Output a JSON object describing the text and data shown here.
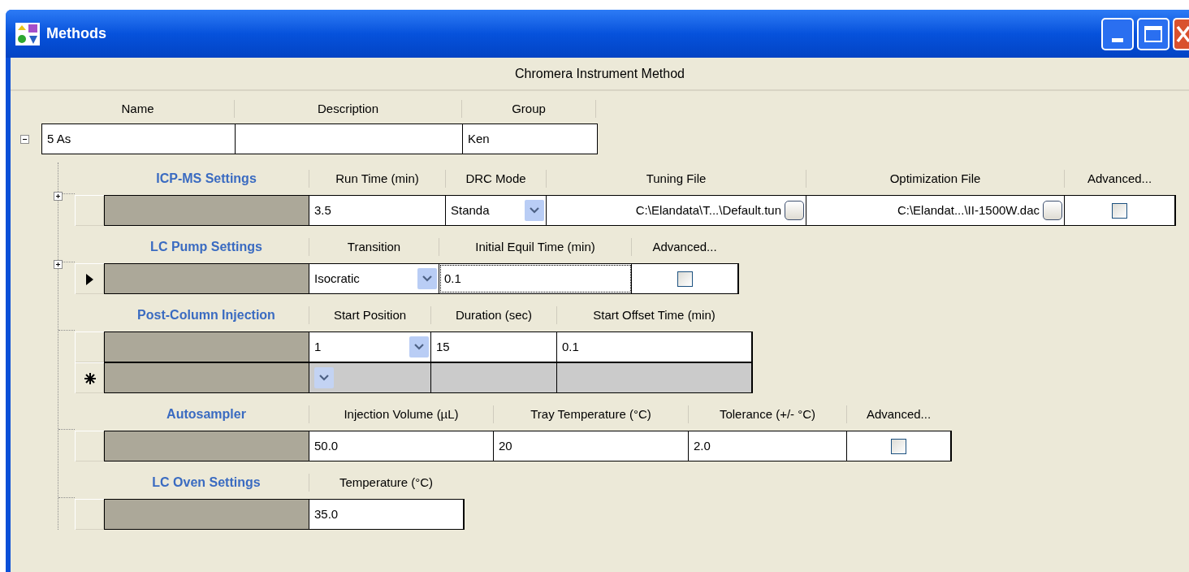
{
  "window": {
    "title": "Methods"
  },
  "banner": "Chromera Instrument Method",
  "method": {
    "expanded": true,
    "columns": [
      "Name",
      "Description",
      "Group"
    ],
    "cells": [
      {
        "value": "5 As"
      },
      {},
      {
        "value": "Ken"
      }
    ]
  },
  "sections": [
    {
      "title": "ICP-MS Settings",
      "expandable": true,
      "columns": [
        "Run Time (min)",
        "DRC Mode",
        "Tuning File",
        "Optimization File",
        "Advanced..."
      ],
      "rows": [
        {
          "current": false,
          "new": false,
          "cells": [
            {
              "kind": "text",
              "value": "3.5"
            },
            {
              "kind": "dropdown",
              "value": "Standa"
            },
            {
              "kind": "file",
              "value": "C:\\Elandata\\T...\\Default.tun"
            },
            {
              "kind": "file",
              "value": "C:\\Elandat...\\II-1500W.dac"
            },
            {
              "kind": "checkbox",
              "checked": false
            }
          ]
        }
      ]
    },
    {
      "title": "LC Pump Settings",
      "expandable": true,
      "columns": [
        "Transition",
        "Initial Equil Time (min)",
        "Advanced..."
      ],
      "rows": [
        {
          "current": true,
          "new": false,
          "cells": [
            {
              "kind": "dropdown",
              "value": "Isocratic"
            },
            {
              "kind": "text",
              "value": "0.1",
              "focused": true
            },
            {
              "kind": "checkbox",
              "checked": false
            }
          ]
        }
      ]
    },
    {
      "title": "Post-Column Injection",
      "expandable": false,
      "columns": [
        "Start Position",
        "Duration (sec)",
        "Start Offset Time (min)"
      ],
      "rows": [
        {
          "current": false,
          "new": false,
          "cells": [
            {
              "kind": "dropdown",
              "value": "1"
            },
            {
              "kind": "text",
              "value": "15"
            },
            {
              "kind": "text",
              "value": "0.1"
            }
          ]
        },
        {
          "current": false,
          "new": true,
          "cells": [
            {
              "kind": "dropdown"
            },
            {
              "kind": "text"
            },
            {
              "kind": "text"
            }
          ]
        }
      ]
    },
    {
      "title": "Autosampler",
      "expandable": false,
      "columns": [
        "Injection Volume (µL)",
        "Tray Temperature (°C)",
        "Tolerance (+/- °C)",
        "Advanced..."
      ],
      "rows": [
        {
          "current": false,
          "new": false,
          "cells": [
            {
              "kind": "text",
              "value": "50.0"
            },
            {
              "kind": "text",
              "value": "20"
            },
            {
              "kind": "text",
              "value": "2.0"
            },
            {
              "kind": "checkbox",
              "checked": false
            }
          ]
        }
      ]
    },
    {
      "title": "LC Oven Settings",
      "expandable": false,
      "columns": [
        "Temperature (°C)"
      ],
      "rows": [
        {
          "current": false,
          "new": false,
          "cells": [
            {
              "kind": "text",
              "value": "35.0"
            }
          ]
        }
      ]
    }
  ]
}
